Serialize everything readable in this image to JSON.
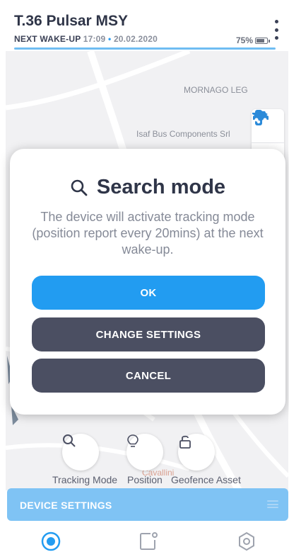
{
  "header": {
    "title": "T.36 Pulsar MSY",
    "wake_label": "NEXT WAKE-UP",
    "wake_time": "17:09",
    "wake_separator": "•",
    "wake_date": "20.02.2020",
    "battery_text": "75%",
    "battery_level": 0.75
  },
  "map": {
    "labels": {
      "mornago": "MORNAGO LEG",
      "isaf": "Isaf Bus Components Srl",
      "cavallini": "Cavallini"
    },
    "tools": [
      {
        "icon": "layers-icon"
      },
      {
        "icon": "traffic-light-icon"
      },
      {
        "icon": "car-icon"
      }
    ]
  },
  "modal": {
    "icon": "search-icon",
    "title": "Search mode",
    "description": "The device will activate tracking mode (position report every 20mins) at the next wake-up.",
    "ok_label": "OK",
    "change_label": "CHANGE SETTINGS",
    "cancel_label": "CANCEL"
  },
  "modes": {
    "tracking": {
      "label": "Tracking Mode",
      "icon": "search-icon"
    },
    "position": {
      "label": "Position",
      "icon": "lightbulb-icon"
    },
    "geofence": {
      "label": "Geofence Asset",
      "icon": "lock-icon"
    }
  },
  "settings_bar": {
    "label": "DEVICE SETTINGS"
  },
  "bottom_nav": [
    {
      "icon": "target-icon",
      "active": true
    },
    {
      "icon": "device-icon",
      "active": false
    },
    {
      "icon": "hexagon-icon",
      "active": false
    }
  ],
  "colors": {
    "accent": "#229cf1",
    "dark_button": "#4b4f62",
    "settings_bar": "#7fc3f4",
    "title": "#2f3548"
  }
}
